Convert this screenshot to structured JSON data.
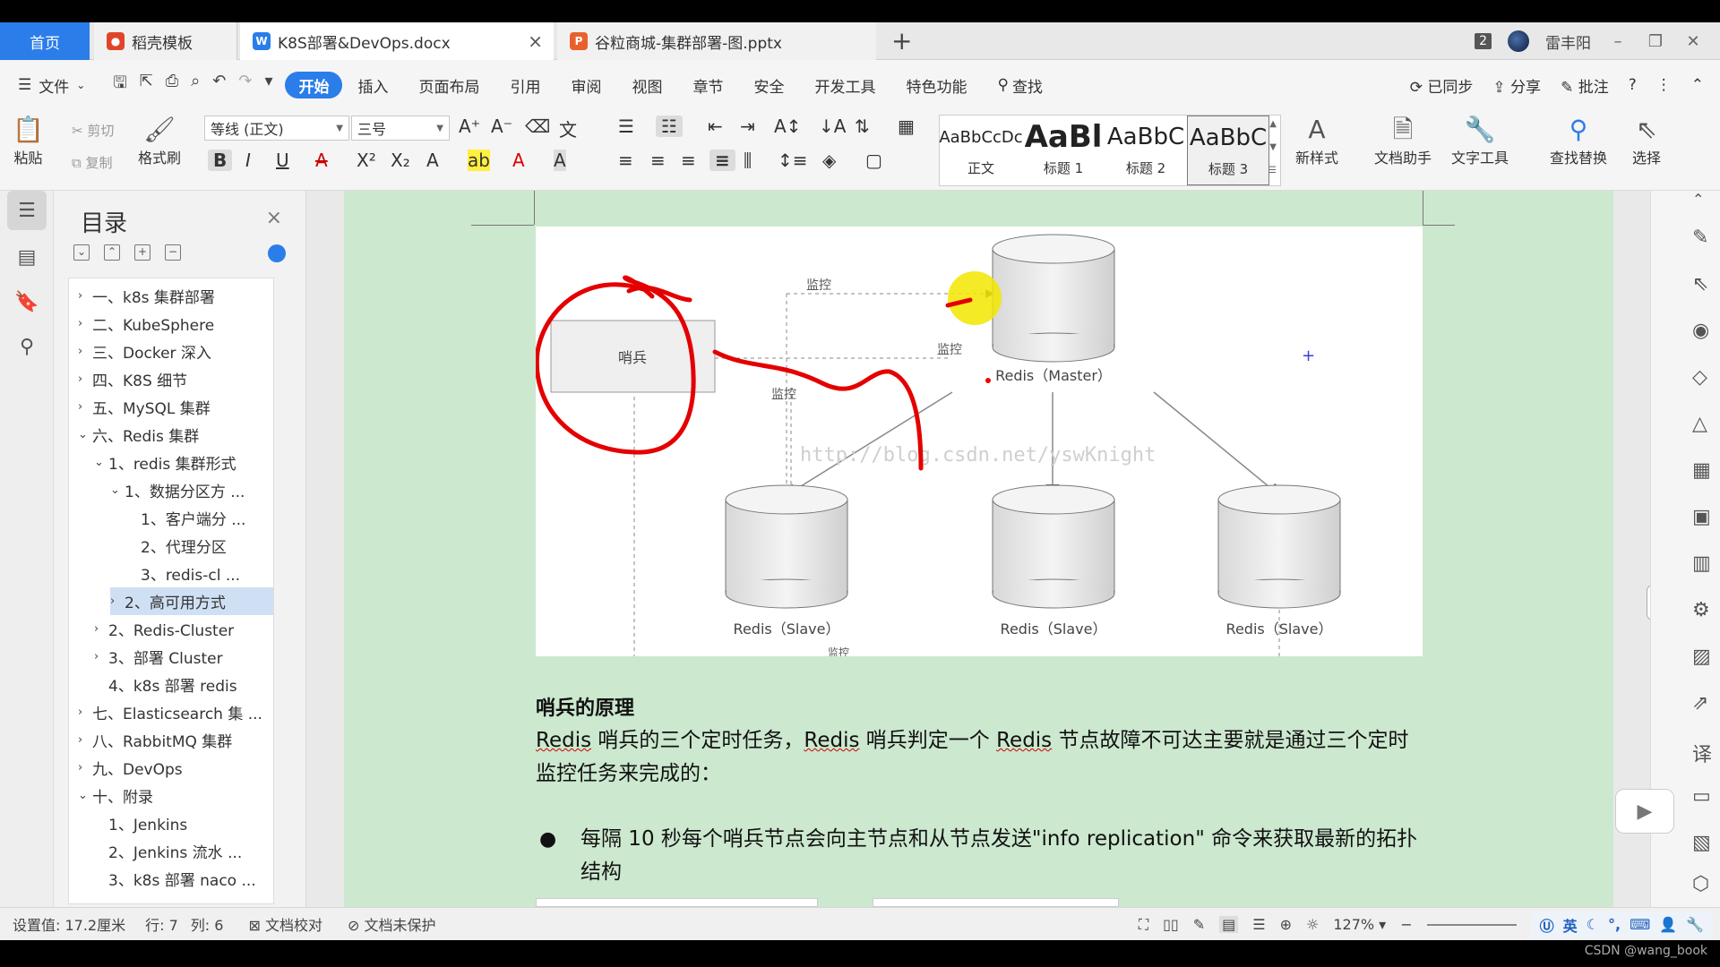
{
  "titlebar": {
    "home_tab": "首页",
    "tab1": "稻壳模板",
    "tab2": "K8S部署&DevOps.docx",
    "tab3": "谷粒商城-集群部署-图.pptx",
    "window_count": "2",
    "user_name": "雷丰阳",
    "brand_colors": {
      "home": "#2b7de9",
      "docer": "#e0452a",
      "word": "#2b7de9",
      "ppt": "#e8612d"
    }
  },
  "menubar": {
    "file": "文件",
    "items": [
      "开始",
      "插入",
      "页面布局",
      "引用",
      "审阅",
      "视图",
      "章节",
      "安全",
      "开发工具",
      "特色功能"
    ],
    "search": "查找",
    "right": [
      "已同步",
      "分享",
      "批注"
    ]
  },
  "ribbon": {
    "paste": "粘贴",
    "cut": "剪切",
    "copy": "复制",
    "format_painter": "格式刷",
    "font_name": "等线 (正文)",
    "font_size": "三号",
    "styles": [
      {
        "sample": "AaBbCcDc",
        "name": "正文"
      },
      {
        "sample": "AaBl",
        "name": "标题 1"
      },
      {
        "sample": "AaBbC",
        "name": "标题 2"
      },
      {
        "sample": "AaBbC",
        "name": "标题 3"
      }
    ],
    "new_style": "新样式",
    "doc_helper": "文档助手",
    "text_tools": "文字工具",
    "find_replace": "查找替换",
    "select": "选择"
  },
  "toc": {
    "title": "目录",
    "items": [
      {
        "label": "一、k8s 集群部署",
        "level": 0,
        "chev": "›"
      },
      {
        "label": "二、KubeSphere",
        "level": 0,
        "chev": "›"
      },
      {
        "label": "三、Docker 深入",
        "level": 0,
        "chev": "›"
      },
      {
        "label": "四、K8S 细节",
        "level": 0,
        "chev": "›"
      },
      {
        "label": "五、MySQL 集群",
        "level": 0,
        "chev": "›"
      },
      {
        "label": "六、Redis 集群",
        "level": 0,
        "chev": "⌄"
      },
      {
        "label": "1、redis 集群形式",
        "level": 1,
        "chev": "⌄"
      },
      {
        "label": "1、数据分区方 ...",
        "level": 2,
        "chev": "⌄"
      },
      {
        "label": "1、客户端分 ...",
        "level": 3,
        "chev": ""
      },
      {
        "label": "2、代理分区",
        "level": 3,
        "chev": ""
      },
      {
        "label": "3、redis-cl ...",
        "level": 3,
        "chev": ""
      },
      {
        "label": "2、高可用方式",
        "level": 2,
        "chev": "›"
      },
      {
        "label": "2、Redis-Cluster",
        "level": 1,
        "chev": "›"
      },
      {
        "label": "3、部署 Cluster",
        "level": 1,
        "chev": "›"
      },
      {
        "label": "4、k8s 部署 redis",
        "level": 1,
        "chev": ""
      },
      {
        "label": "七、Elasticsearch 集 ...",
        "level": 0,
        "chev": "›"
      },
      {
        "label": "八、RabbitMQ 集群",
        "level": 0,
        "chev": "›"
      },
      {
        "label": "九、DevOps",
        "level": 0,
        "chev": "›"
      },
      {
        "label": "十、附录",
        "level": 0,
        "chev": "⌄"
      },
      {
        "label": "1、Jenkins",
        "level": 1,
        "chev": ""
      },
      {
        "label": "2、Jenkins 流水 ...",
        "level": 1,
        "chev": ""
      },
      {
        "label": "3、k8s 部署 naco ...",
        "level": 1,
        "chev": ""
      }
    ],
    "highlighted_index": 11
  },
  "diagram": {
    "sentinel": "哨兵",
    "monitor1": "监控",
    "monitor2": "监控",
    "monitor3": "监控",
    "monitor4": "监控",
    "master": "Redis（Master）",
    "slave1": "Redis（Slave）",
    "slave2": "Redis（Slave）",
    "slave3": "Redis（Slave）",
    "watermark": "http://blog.csdn.net/yswKnight"
  },
  "document": {
    "heading": "哨兵的原理",
    "para_parts": [
      "Redis",
      " 哨兵的三个定时任务，",
      "Redis",
      " 哨兵判定一个 ",
      "Redis",
      " 节点故障不可达主要就是通过三个定时监控任务来完成的："
    ],
    "bullet": "每隔 10 秒每个哨兵节点会向主节点和从节点发送\"info replication\" 命令来获取最新的拓扑结构"
  },
  "status": {
    "setting": "设置值: 17.2厘米",
    "row": "行: 7",
    "col": "列: 6",
    "proof": "文档校对",
    "protect": "文档未保护",
    "zoom": "127%",
    "ime": "英"
  },
  "watermark_text": "CSDN @wang_book"
}
